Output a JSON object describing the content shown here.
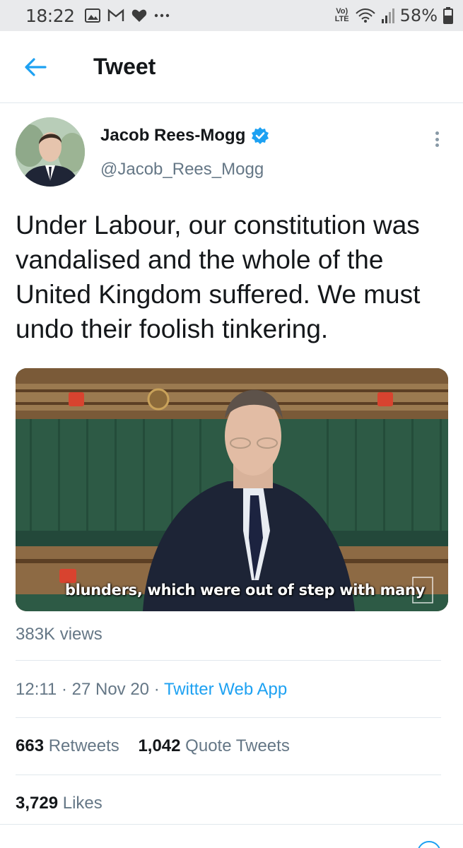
{
  "status_bar": {
    "time": "18:22",
    "battery": "58%",
    "network": "VoLTE",
    "icons_left": [
      "gallery-icon",
      "gmail-icon",
      "heart-icon",
      "more-notifications-icon"
    ],
    "icons_right": [
      "volte-icon",
      "wifi-icon",
      "signal-icon",
      "battery-icon"
    ]
  },
  "header": {
    "title": "Tweet",
    "back_icon": "arrow-left-icon"
  },
  "tweet": {
    "author_name": "Jacob Rees-Mogg",
    "verified": true,
    "handle": "@Jacob_Rees_Mogg",
    "text": "Under Labour, our constitution was vandalised and the whole of the United Kingdom suffered. We must undo their foolish tinkering.",
    "media": {
      "subtitle": "blunders, which were out of step with many"
    },
    "views": "383K views",
    "time": "12:11",
    "separator": "·",
    "date": "27 Nov 20",
    "source": "Twitter Web App",
    "retweets_count": "663",
    "retweets_label": "Retweets",
    "quotes_count": "1,042",
    "quotes_label": "Quote Tweets",
    "likes_count": "3,729",
    "likes_label": "Likes"
  },
  "colors": {
    "accent": "#1da1f2",
    "text_primary": "#14171a",
    "text_secondary": "#657786",
    "status_bar_bg": "#e9eaec"
  }
}
